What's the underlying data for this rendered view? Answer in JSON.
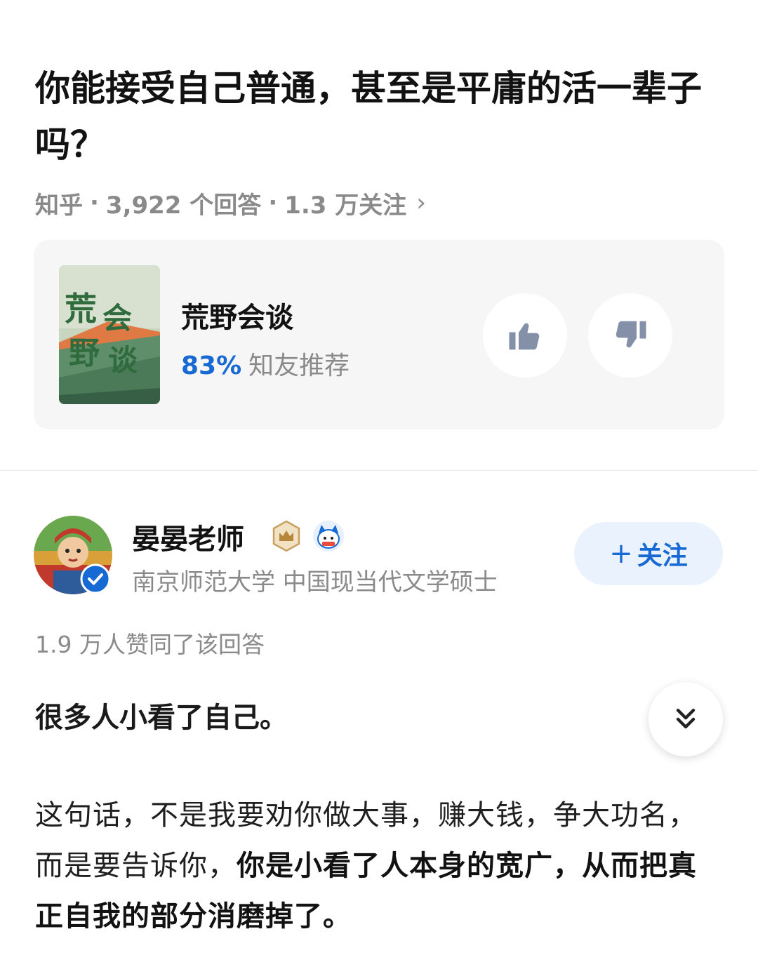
{
  "question": {
    "title": "你能接受自己普通，甚至是平庸的活一辈子吗？",
    "source": "知乎",
    "answers": "3,922 个回答",
    "followers": "1.3 万关注",
    "sep": "·",
    "chevron": "›"
  },
  "card": {
    "cover_icon": "book-cover-image",
    "title": "荒野会谈",
    "percent": "83%",
    "recommend_label": "知友推荐",
    "thumb_up_icon": "thumbs-up-icon",
    "thumb_down_icon": "thumbs-down-icon"
  },
  "author": {
    "name": "晏晏老师",
    "description": "南京师范大学 中国现当代文学硕士",
    "follow_plus": "+",
    "follow_label": "关注",
    "avatar_icon": "avatar-image",
    "verified_icon": "verified-check-icon",
    "badge1_icon": "crown-badge-icon",
    "badge2_icon": "mascot-badge-icon"
  },
  "answer": {
    "likes": "1.9 万人赞同了该回答",
    "lead": "很多人小看了自己。",
    "body_normal": "这句话，不是我要劝你做大事，赚大钱，争大功名，而是要告诉你，",
    "body_bold": "你是小看了人本身的宽广，从而把真正自我的部分消磨掉了。",
    "expand_icon": "double-chevron-down-icon"
  },
  "colors": {
    "accent_blue": "#1769d3",
    "follow_bg": "#e9f2fd",
    "card_bg": "#f6f6f6",
    "muted_text": "#8a8a8a",
    "icon_gray": "#8390a8"
  }
}
